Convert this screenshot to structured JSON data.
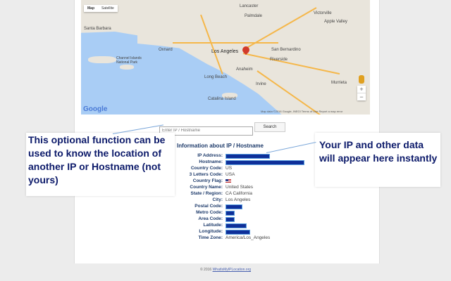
{
  "map": {
    "tabs": [
      "Map",
      "Satellite"
    ],
    "labels": [
      "Lancaster",
      "Victorville",
      "Apple Valley",
      "Palmdale",
      "Santa Barbara",
      "Oxnard",
      "Los Angeles",
      "San Bernardino",
      "Channel Islands National Park",
      "Anaheim",
      "Riverside",
      "Long Beach",
      "Irvine",
      "Catalina Island",
      "Murrieta"
    ],
    "google_logo": "Google",
    "attribution": "Map data ©2016 Google, INEGI   Terms of Use   Report a map error",
    "zoom_in": "+",
    "zoom_out": "−"
  },
  "search": {
    "placeholder": "Enter IP / Hostname",
    "button": "Search"
  },
  "callouts": {
    "left": "This optional function can be used to know the location of another IP or Hostname (not yours)",
    "right": "Your IP and other data will appear here instantly"
  },
  "info": {
    "title": "Information about IP / Hostname",
    "rows": [
      {
        "label": "IP Address:",
        "value": "",
        "redacted": 0.55
      },
      {
        "label": "Hostname:",
        "value": "",
        "redacted": 1.0
      },
      {
        "label": "Country Code:",
        "value": "US"
      },
      {
        "label": "3 Letters Code:",
        "value": "USA"
      },
      {
        "label": "Country Flag:",
        "value": ""
      },
      {
        "label": "Country Name:",
        "value": "United States"
      },
      {
        "label": "State / Region:",
        "value": "CA California"
      },
      {
        "label": "City:",
        "value": "Los Angeles"
      },
      {
        "label": "Postal Code:",
        "value": "",
        "redacted": 0.2
      },
      {
        "label": "Metro Code:",
        "value": "",
        "redacted": 0.1
      },
      {
        "label": "Area Code:",
        "value": "",
        "redacted": 0.1
      },
      {
        "label": "Latitude:",
        "value": "",
        "redacted": 0.25
      },
      {
        "label": "Longitude:",
        "value": "",
        "redacted": 0.3
      },
      {
        "label": "Time Zone:",
        "value": "America/Los_Angeles"
      }
    ]
  },
  "footer": {
    "prefix": "© 2016",
    "link": "WhatIsMyIPLocation.org"
  }
}
